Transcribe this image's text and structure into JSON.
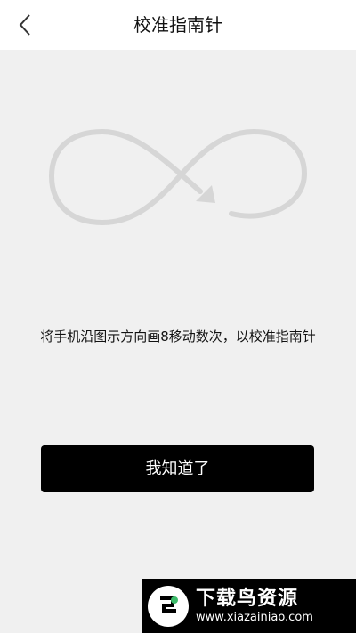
{
  "header": {
    "title": "校准指南针",
    "back_icon": "chevron-left-icon"
  },
  "main": {
    "illustration_icon": "figure-eight-arrow-icon",
    "instruction": "将手机沿图示方向画8移动数次，以校准指南针",
    "ok_button_label": "我知道了"
  },
  "watermark": {
    "title": "下载鸟资源",
    "url": "www.xiazainiao.com"
  },
  "colors": {
    "background": "#f0f0f0",
    "header": "#ffffff",
    "button": "#000000",
    "button_text": "#ffffff",
    "illustration": "#d6d6d6"
  }
}
